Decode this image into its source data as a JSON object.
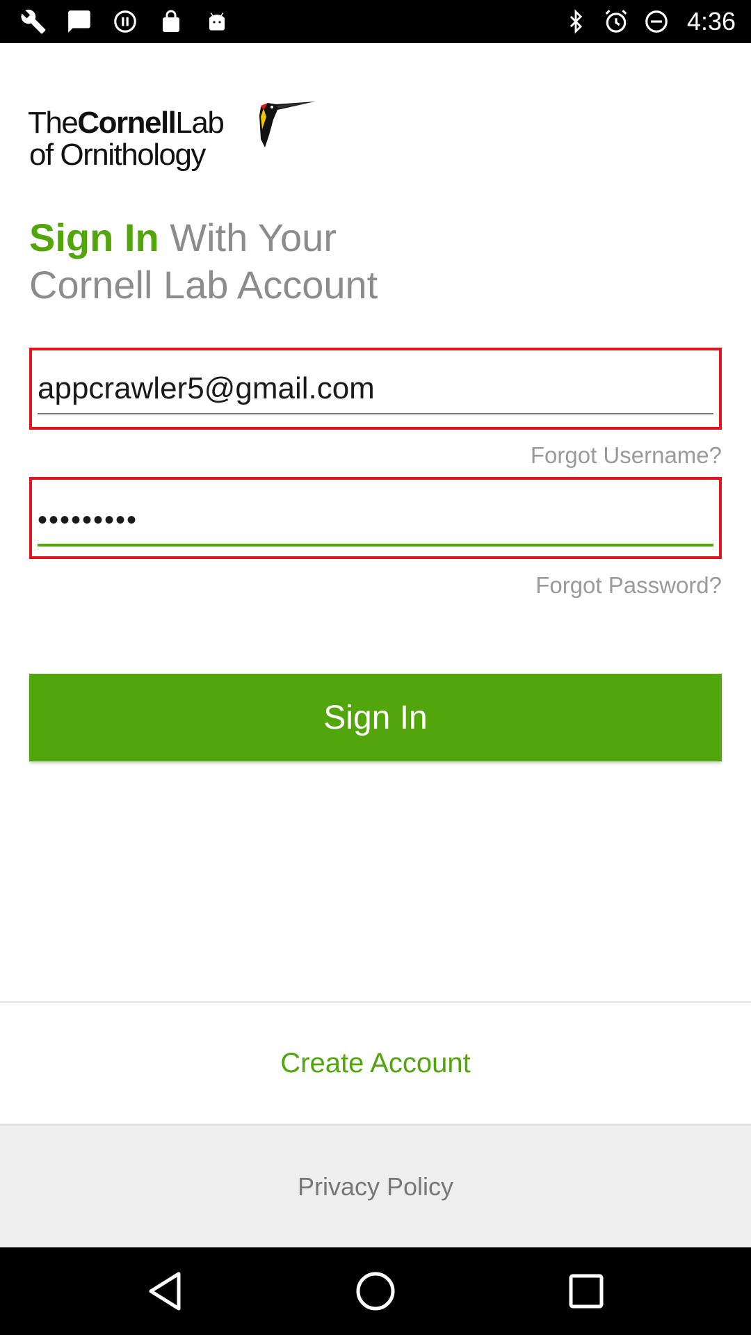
{
  "status_bar": {
    "left_icons": [
      "wrench-icon",
      "message-icon",
      "pause-circle-icon",
      "lock-icon",
      "android-icon"
    ],
    "right_icons": [
      "bluetooth-icon",
      "alarm-icon",
      "do-not-disturb-icon"
    ],
    "time": "4:36"
  },
  "logo": {
    "line1_thin_a": "The",
    "line1_bold": "Cornell",
    "line1_thin_b": "Lab",
    "line2": "of Ornithology",
    "icon": "woodpecker-icon"
  },
  "heading": {
    "highlight": "Sign In",
    "rest_line1": " With Your",
    "line2": "Cornell Lab Account"
  },
  "form": {
    "email_value": "appcrawler5@gmail.com",
    "forgot_username": "Forgot Username?",
    "password_value": "•••••••••",
    "forgot_password": "Forgot Password?",
    "sign_in_label": "Sign In"
  },
  "footer": {
    "create_account": "Create Account",
    "privacy_policy": "Privacy Policy"
  },
  "nav_bar": {
    "buttons": [
      "back-icon",
      "home-icon",
      "recents-icon"
    ]
  },
  "colors": {
    "accent_green": "#52a50a",
    "field_error_border": "#e2141d",
    "heading_gray": "#8c8c8c"
  }
}
